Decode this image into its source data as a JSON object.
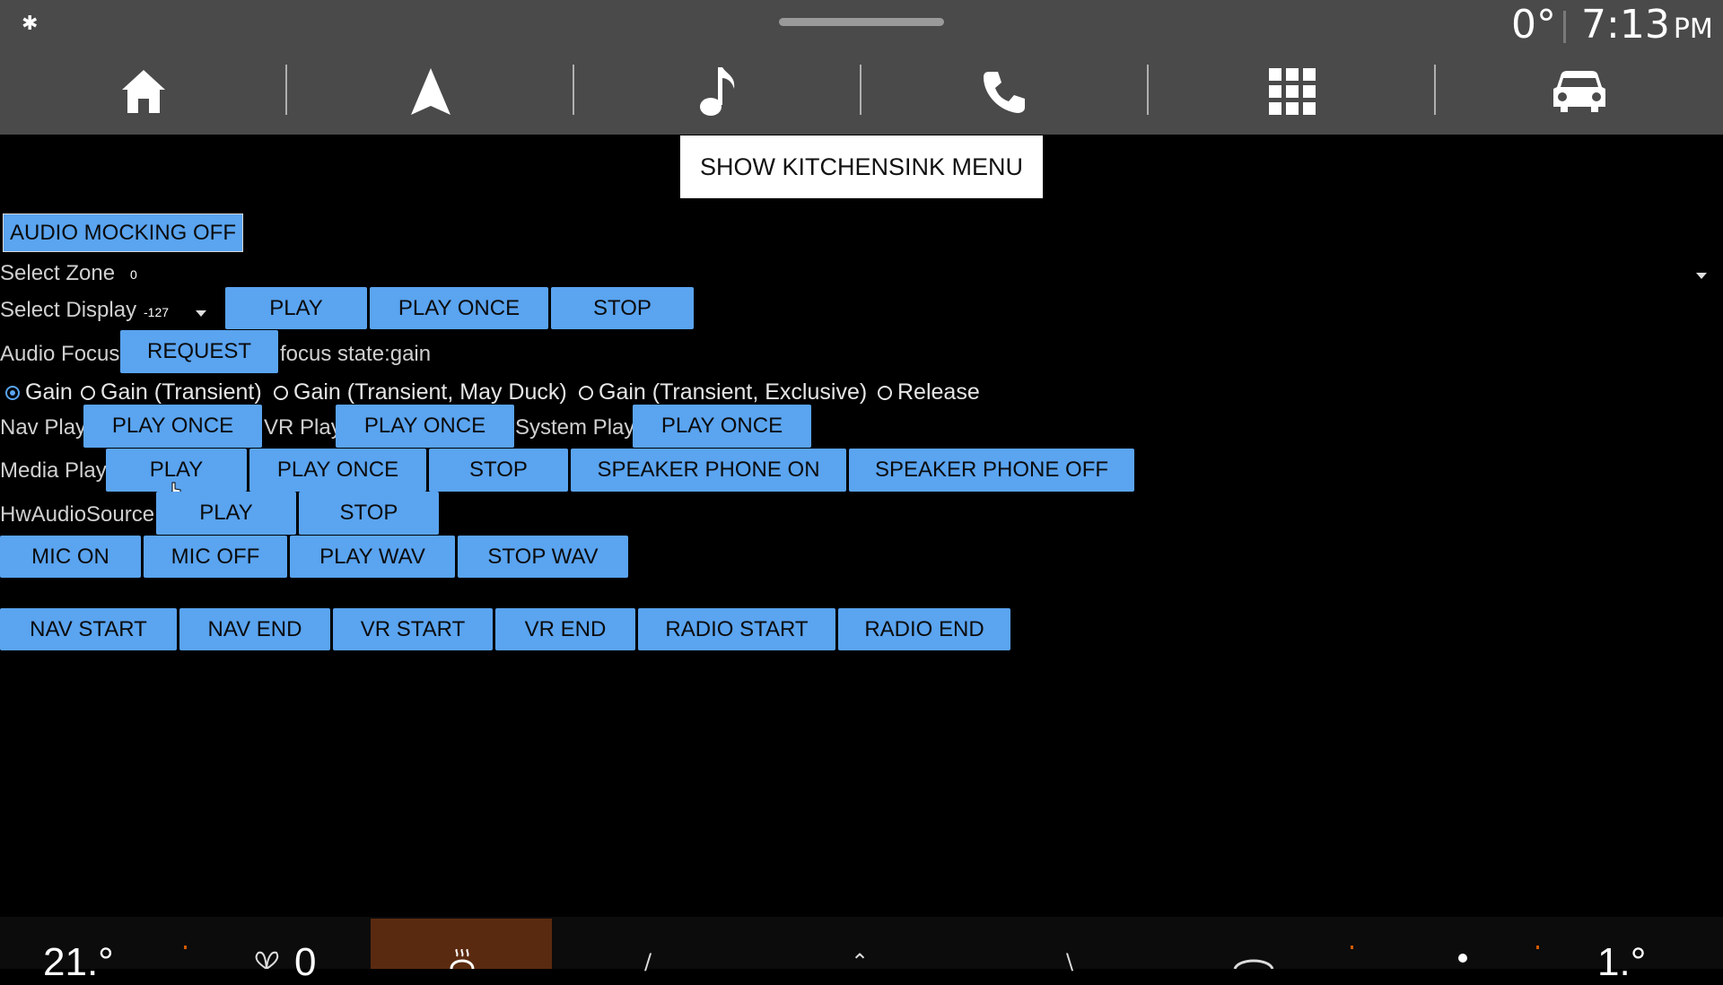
{
  "status_bar": {
    "bluetooth_icon": "bluetooth-icon",
    "outside_temp": "0°",
    "time": "7:13",
    "ampm": "PM"
  },
  "nav_bar": {
    "items": [
      {
        "name": "home",
        "icon": "home-icon"
      },
      {
        "name": "navigation",
        "icon": "navigation-arrow-icon"
      },
      {
        "name": "music",
        "icon": "music-note-icon"
      },
      {
        "name": "phone",
        "icon": "phone-icon"
      },
      {
        "name": "apps",
        "icon": "apps-grid-icon"
      },
      {
        "name": "car",
        "icon": "car-icon"
      }
    ]
  },
  "main": {
    "kitchensink_button": "SHOW KITCHENSINK MENU",
    "audio_mocking_button": "AUDIO MOCKING OFF",
    "select_zone_label": "Select Zone",
    "select_zone_value": "0",
    "select_display_label": "Select Display",
    "select_display_value": "-127",
    "display_play": "PLAY",
    "display_play_once": "PLAY ONCE",
    "display_stop": "STOP",
    "audio_focus_label": "Audio Focus",
    "request_button": "REQUEST",
    "focus_state": "focus state:gain",
    "radio_options": [
      "Gain",
      "Gain (Transient)",
      "Gain (Transient, May Duck)",
      "Gain (Transient, Exclusive)",
      "Release"
    ],
    "radio_selected_index": 0,
    "nav_play_label": "Nav Play",
    "nav_play_once": "PLAY ONCE",
    "vr_play_label": "VR Play",
    "vr_play_once": "PLAY ONCE",
    "system_play_label": "System Play",
    "system_play_once": "PLAY ONCE",
    "media_play_label": "Media Play",
    "media_play": "PLAY",
    "media_play_once": "PLAY ONCE",
    "media_stop": "STOP",
    "speaker_on": "SPEAKER PHONE ON",
    "speaker_off": "SPEAKER PHONE OFF",
    "hw_audio_label": "HwAudioSource",
    "hw_play": "PLAY",
    "hw_stop": "STOP",
    "mic_on": "MIC ON",
    "mic_off": "MIC OFF",
    "play_wav": "PLAY WAV",
    "stop_wav": "STOP WAV",
    "nav_start": "NAV START",
    "nav_end": "NAV END",
    "vr_start": "VR START",
    "vr_end": "VR END",
    "radio_start": "RADIO START",
    "radio_end": "RADIO END"
  },
  "climate_bar": {
    "driver_temp": "21.°",
    "fan_speed": "0",
    "passenger_temp": "1.°"
  },
  "colors": {
    "button_blue": "#5aa4f0",
    "top_bar": "#4a4a4a",
    "heated_seat_active": "#5a2a10"
  }
}
